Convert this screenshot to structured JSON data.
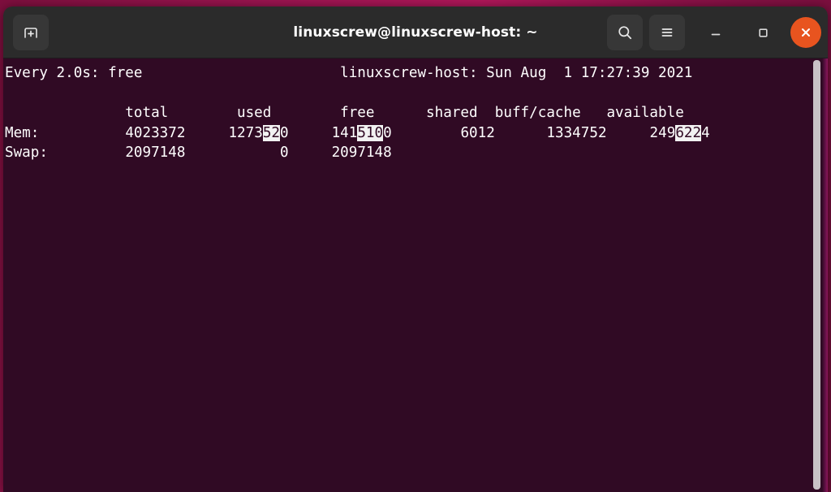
{
  "window": {
    "title": "linuxscrew@linuxscrew-host: ~",
    "titlebar_bg": "#2b2b2b",
    "terminal_bg": "#300a24",
    "close_button_color": "#e8541f",
    "text_color": "#ffffff",
    "highlight_bg": "#f2f2f2"
  },
  "titlebar": {
    "new_tab_icon": "new-tab-icon",
    "search_icon": "search-icon",
    "menu_icon": "hamburger-menu-icon",
    "minimize_icon": "minimize-icon",
    "maximize_icon": "maximize-icon",
    "close_icon": "close-icon"
  },
  "terminal": {
    "watch_header": {
      "left": "Every 2.0s: free",
      "right": "linuxscrew-host: Sun Aug  1 17:27:39 2021",
      "interval": "2.0s",
      "command": "free",
      "hostname": "linuxscrew-host",
      "timestamp": "Sun Aug  1 17:27:39 2021"
    },
    "blank_line": "",
    "table": {
      "columns": [
        "",
        "total",
        "used",
        "free",
        "shared",
        "buff/cache",
        "available"
      ],
      "header_line": "              total        used        free      shared  buff/cache   available",
      "rows": [
        {
          "label": "Mem:",
          "total": "4023372",
          "used": "1273520",
          "used_plain_prefix": "1273",
          "used_highlight": "52",
          "used_plain_suffix": "0",
          "free": "1415100",
          "free_plain_prefix": "141",
          "free_highlight": "510",
          "free_plain_suffix": "0",
          "shared": "6012",
          "buff_cache": "1334752",
          "available": "2496224",
          "available_plain_prefix": "249",
          "available_highlight": "622",
          "available_plain_suffix": "4"
        },
        {
          "label": "Swap:",
          "total": "2097148",
          "used": "0",
          "free": "2097148",
          "shared": "",
          "buff_cache": "",
          "available": ""
        }
      ]
    }
  },
  "scrollbar": {
    "thumb_color": "#c8c2c6"
  }
}
